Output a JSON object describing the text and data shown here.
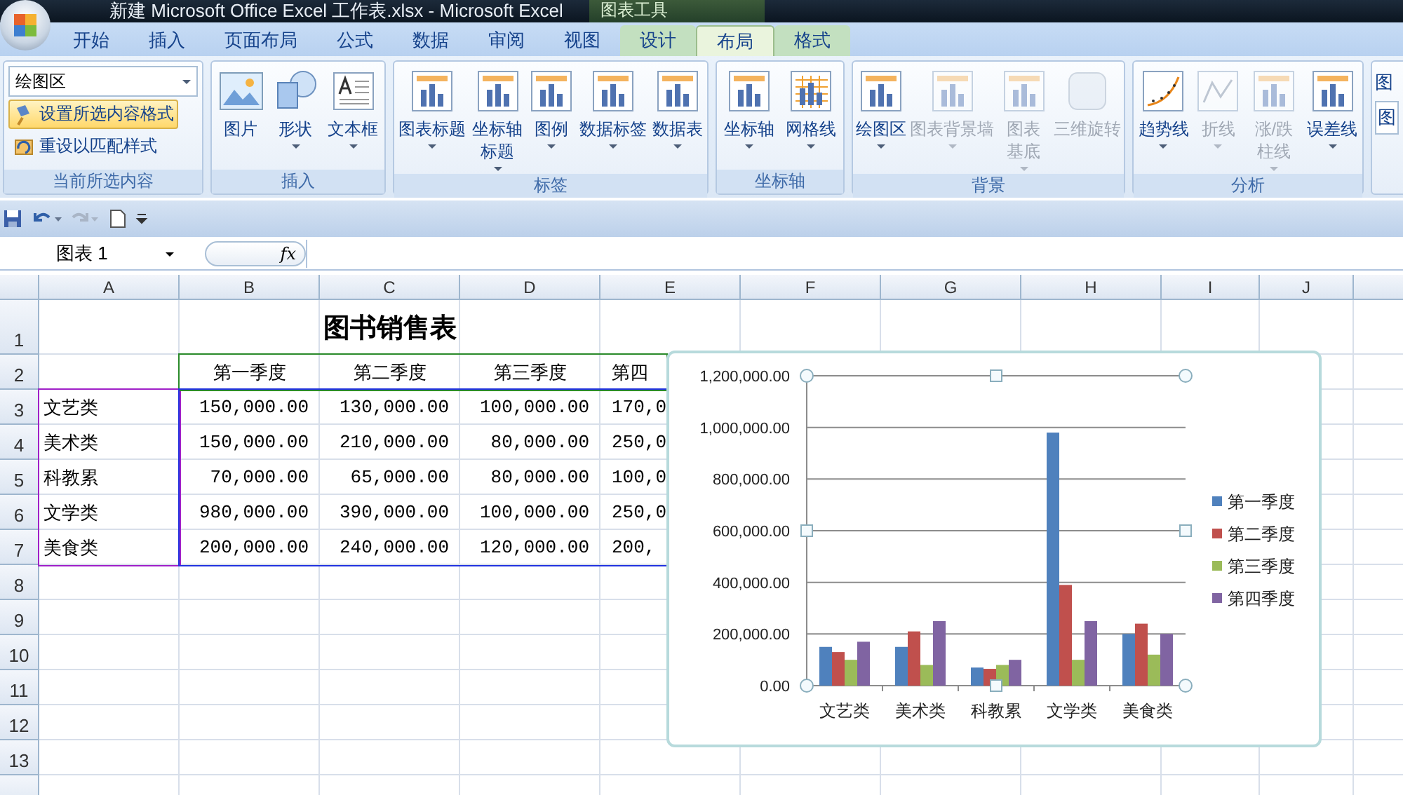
{
  "window": {
    "title": "新建 Microsoft Office Excel 工作表.xlsx - Microsoft Excel",
    "context_title": "图表工具"
  },
  "ribbon_tabs": [
    {
      "label": "开始",
      "selected": false,
      "contextual": false
    },
    {
      "label": "插入",
      "selected": false,
      "contextual": false
    },
    {
      "label": "页面布局",
      "selected": false,
      "contextual": false
    },
    {
      "label": "公式",
      "selected": false,
      "contextual": false
    },
    {
      "label": "数据",
      "selected": false,
      "contextual": false
    },
    {
      "label": "审阅",
      "selected": false,
      "contextual": false
    },
    {
      "label": "视图",
      "selected": false,
      "contextual": false
    },
    {
      "label": "设计",
      "selected": false,
      "contextual": true
    },
    {
      "label": "布局",
      "selected": true,
      "contextual": true
    },
    {
      "label": "格式",
      "selected": false,
      "contextual": true
    }
  ],
  "ribbon_groups": [
    {
      "kind": "selection",
      "title": "当前所选内容",
      "dropdown": "绘图区",
      "items": [
        {
          "label": "设置所选内容格式",
          "selected": true
        },
        {
          "label": "重设以匹配样式",
          "selected": false
        }
      ]
    },
    {
      "kind": "large",
      "title": "插入",
      "buttons": [
        {
          "label": "图片",
          "dropdown": false,
          "disabled": false
        },
        {
          "label": "形状",
          "dropdown": true,
          "disabled": false
        },
        {
          "label": "文本框",
          "dropdown": true,
          "disabled": false
        }
      ]
    },
    {
      "kind": "large",
      "title": "标签",
      "buttons": [
        {
          "label": "图表标题",
          "dropdown": true,
          "disabled": false
        },
        {
          "label": "坐标轴标题",
          "dropdown": true,
          "disabled": false,
          "wrap": true
        },
        {
          "label": "图例",
          "dropdown": true,
          "disabled": false
        },
        {
          "label": "数据标签",
          "dropdown": true,
          "disabled": false
        },
        {
          "label": "数据表",
          "dropdown": true,
          "disabled": false
        }
      ]
    },
    {
      "kind": "large",
      "title": "坐标轴",
      "buttons": [
        {
          "label": "坐标轴",
          "dropdown": true,
          "disabled": false
        },
        {
          "label": "网格线",
          "dropdown": true,
          "disabled": false
        }
      ]
    },
    {
      "kind": "large",
      "title": "背景",
      "buttons": [
        {
          "label": "绘图区",
          "dropdown": true,
          "disabled": false
        },
        {
          "label": "图表背景墙",
          "dropdown": true,
          "disabled": true
        },
        {
          "label": "图表基底",
          "dropdown": true,
          "disabled": true,
          "wrap": true
        },
        {
          "label": "三维旋转",
          "dropdown": false,
          "disabled": true
        }
      ]
    },
    {
      "kind": "large",
      "title": "分析",
      "buttons": [
        {
          "label": "趋势线",
          "dropdown": true,
          "disabled": false
        },
        {
          "label": "折线",
          "dropdown": true,
          "disabled": true
        },
        {
          "label": "涨/跌柱线",
          "dropdown": true,
          "disabled": true,
          "wrap": true
        },
        {
          "label": "误差线",
          "dropdown": true,
          "disabled": false
        }
      ]
    },
    {
      "kind": "partial",
      "items": [
        "图",
        "图"
      ]
    }
  ],
  "formula_bar": {
    "name_box": "图表 1",
    "function_label": "fx"
  },
  "sheet": {
    "columns": [
      "A",
      "B",
      "C",
      "D",
      "E",
      "F",
      "G",
      "H",
      "I",
      "J"
    ],
    "row_numbers": [
      "1",
      "2",
      "3",
      "4",
      "5",
      "6",
      "7",
      "8",
      "9",
      "10",
      "11",
      "12",
      "13"
    ],
    "title": "图书销售表",
    "rows": [
      {
        "label": "",
        "values": [
          "第一季度",
          "第二季度",
          "第三季度",
          "第四"
        ]
      },
      {
        "label": "文艺类",
        "values": [
          "150,000.00",
          "130,000.00",
          "100,000.00",
          "170,0"
        ]
      },
      {
        "label": "美术类",
        "values": [
          "150,000.00",
          "210,000.00",
          "80,000.00",
          "250,0"
        ]
      },
      {
        "label": "科教累",
        "values": [
          "70,000.00",
          "65,000.00",
          "80,000.00",
          "100,0"
        ]
      },
      {
        "label": "文学类",
        "values": [
          "980,000.00",
          "390,000.00",
          "100,000.00",
          "250,0"
        ]
      },
      {
        "label": "美食类",
        "values": [
          "200,000.00",
          "240,000.00",
          "120,000.00",
          "200,"
        ]
      }
    ]
  },
  "chart": {
    "chart_data": {
      "type": "bar",
      "categories": [
        "文艺类",
        "美术类",
        "科教累",
        "文学类",
        "美食类"
      ],
      "series": [
        {
          "name": "第一季度",
          "color": "#4f81bd",
          "values": [
            150000,
            150000,
            70000,
            980000,
            200000
          ]
        },
        {
          "name": "第二季度",
          "color": "#c0504d",
          "values": [
            130000,
            210000,
            65000,
            390000,
            240000
          ]
        },
        {
          "name": "第三季度",
          "color": "#9bbb59",
          "values": [
            100000,
            80000,
            80000,
            100000,
            120000
          ]
        },
        {
          "name": "第四季度",
          "color": "#8064a2",
          "values": [
            170000,
            250000,
            100000,
            250000,
            200000
          ]
        }
      ],
      "ylim": [
        0,
        1200000
      ],
      "yticks": [
        {
          "value": 0,
          "label": "0.00"
        },
        {
          "value": 200000,
          "label": "200,000.00"
        },
        {
          "value": 400000,
          "label": "400,000.00"
        },
        {
          "value": 600000,
          "label": "600,000.00"
        },
        {
          "value": 800000,
          "label": "800,000.00"
        },
        {
          "value": 1000000,
          "label": "1,000,000.00"
        },
        {
          "value": 1200000,
          "label": "1,200,000.00"
        }
      ],
      "grid": true,
      "legend": true
    }
  }
}
